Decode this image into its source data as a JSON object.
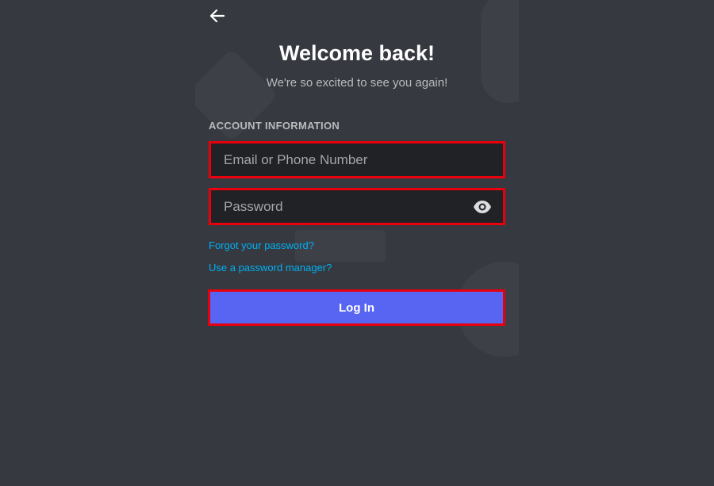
{
  "header": {
    "back_icon": "arrow-left-icon",
    "title": "Welcome back!",
    "subtitle": "We're so excited to see you again!"
  },
  "form": {
    "section_label": "ACCOUNT INFORMATION",
    "email": {
      "placeholder": "Email or Phone Number",
      "value": ""
    },
    "password": {
      "placeholder": "Password",
      "value": "",
      "toggle_icon": "eye-icon"
    },
    "forgot_password_label": "Forgot your password?",
    "password_manager_label": "Use a password manager?",
    "login_label": "Log In"
  },
  "colors": {
    "background": "#36393f",
    "input_background": "#202225",
    "link": "#00b0f4",
    "button": "#5865f2",
    "highlight_border": "#e8000d"
  }
}
